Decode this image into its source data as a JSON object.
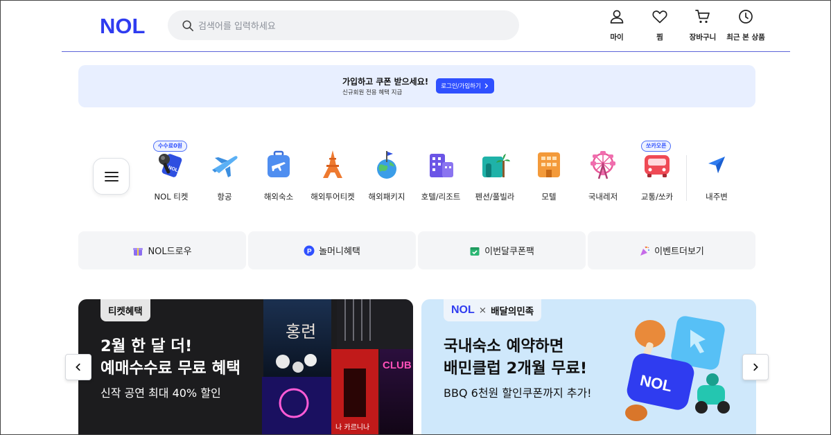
{
  "header": {
    "logo": "NOL",
    "search_placeholder": "검색어를 입력하세요",
    "nav": [
      {
        "label": "마이",
        "icon": "user-icon"
      },
      {
        "label": "찜",
        "icon": "heart-icon"
      },
      {
        "label": "장바구니",
        "icon": "cart-icon"
      },
      {
        "label": "최근 본 상품",
        "icon": "clock-icon"
      }
    ]
  },
  "promo": {
    "title": "가입하고 쿠폰 받으세요!",
    "subtitle": "신규회원 전용 혜택 지급",
    "button": "로그인/가입하기"
  },
  "categories": [
    {
      "label": "NOL 티켓",
      "icon": "ticket-microphone-icon",
      "badge": "수수료0원"
    },
    {
      "label": "항공",
      "icon": "airplane-icon"
    },
    {
      "label": "해외숙소",
      "icon": "suitcase-icon"
    },
    {
      "label": "해외투어티켓",
      "icon": "eiffel-tower-icon"
    },
    {
      "label": "해외패키지",
      "icon": "globe-flag-icon"
    },
    {
      "label": "호텔/리조트",
      "icon": "hotel-icon"
    },
    {
      "label": "펜션/풀빌라",
      "icon": "palm-villa-icon"
    },
    {
      "label": "모텔",
      "icon": "motel-icon"
    },
    {
      "label": "국내레저",
      "icon": "ferris-wheel-icon"
    },
    {
      "label": "교통/쏘카",
      "icon": "bus-icon",
      "badge": "쏘카오픈"
    },
    {
      "label": "내주변",
      "icon": "location-arrow-icon"
    }
  ],
  "quick_tabs": [
    {
      "label": "NOL드로우",
      "icon": "gift-icon"
    },
    {
      "label": "놀머니혜택",
      "icon": "p-coin-icon"
    },
    {
      "label": "이번달쿠폰팩",
      "icon": "calendar-check-icon"
    },
    {
      "label": "이벤트더보기",
      "icon": "party-popper-icon"
    }
  ],
  "banners": [
    {
      "tag": "티켓혜택",
      "line1": "2월 한 달 더!",
      "line2": "예매수수료 무료 혜택",
      "sub": "신작 공연 최대 40% 할인",
      "poster_texts": [
        "홍련",
        "CLUB LAT",
        "나 카르니나"
      ]
    },
    {
      "tag_logo": "NOL",
      "tag_x": "×",
      "tag_partner": "배달의민족",
      "line1": "국내숙소 예약하면",
      "line2": "배민클럽 2개월 무료!",
      "sub": "BBQ 6천원 할인쿠폰까지 추가!",
      "art_text": "NOL"
    }
  ],
  "colors": {
    "brand": "#2f50ff",
    "promo_bg": "#e8efff",
    "banner2_bg": "#cfe8fb"
  }
}
